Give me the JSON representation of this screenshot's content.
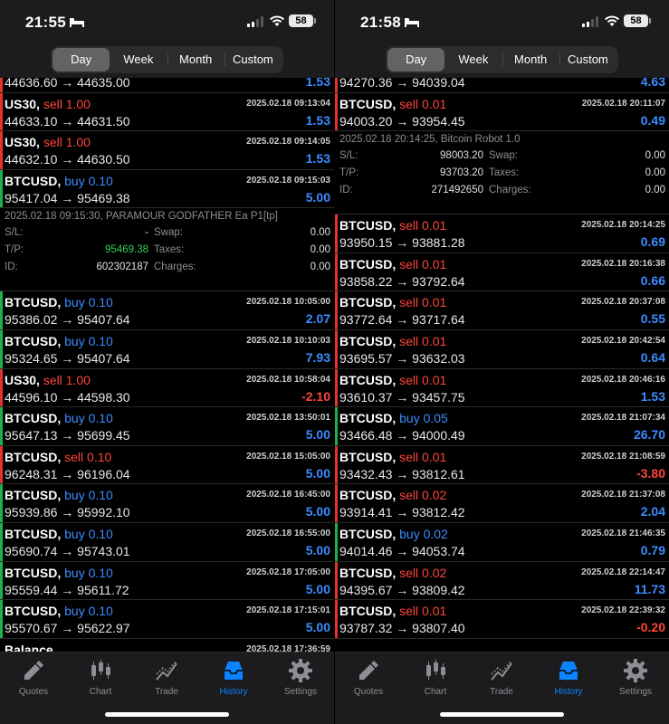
{
  "colors": {
    "buy": "#3b8cff",
    "sell": "#ff453a",
    "positive": "#3b8cff",
    "negative": "#ff453a",
    "accent": "#0a84ff",
    "tp_green": "#30d158"
  },
  "tabs": [
    {
      "label": "Quotes",
      "icon": "quotes-icon"
    },
    {
      "label": "Chart",
      "icon": "chart-icon"
    },
    {
      "label": "Trade",
      "icon": "trade-icon"
    },
    {
      "label": "History",
      "icon": "history-icon",
      "active": true
    },
    {
      "label": "Settings",
      "icon": "settings-icon"
    }
  ],
  "segments": [
    "Day",
    "Week",
    "Month",
    "Custom"
  ],
  "screens": [
    {
      "time": "21:55",
      "battery": "58",
      "active_segment": "Day",
      "top_partial": {
        "bar": "red",
        "prices": "44636.60 → 44635.00",
        "pl": "1.53",
        "pl_class": "pos"
      },
      "rows": [
        {
          "type": "deal",
          "bar": "red",
          "symbol": "US30,",
          "side": "sell",
          "volume": "1.00",
          "datetime": "2025.02.18 09:13:04",
          "prices": "44633.10 → 44631.50",
          "pl": "1.53"
        },
        {
          "type": "deal",
          "bar": "red",
          "symbol": "US30,",
          "side": "sell",
          "volume": "1.00",
          "datetime": "2025.02.18 09:14:05",
          "prices": "44632.10 → 44630.50",
          "pl": "1.53"
        },
        {
          "type": "deal",
          "bar": "green",
          "symbol": "BTCUSD,",
          "side": "buy",
          "volume": "0.10",
          "datetime": "2025.02.18 09:15:03",
          "prices": "95417.04 → 95469.38",
          "pl": "5.00"
        },
        {
          "type": "detail",
          "header": "2025.02.18 09:15:30, PARAMOUR GODFATHER Ea P1[tp]",
          "sl_label": "S/L:",
          "sl": "-",
          "tp_label": "T/P:",
          "tp": "95469.38",
          "id_label": "ID:",
          "id": "602302187",
          "swap_label": "Swap:",
          "swap": "0.00",
          "taxes_label": "Taxes:",
          "taxes": "0.00",
          "charges_label": "Charges:",
          "charges": "0.00",
          "tp_green": true
        },
        {
          "type": "deal",
          "bar": "green",
          "symbol": "BTCUSD,",
          "side": "buy",
          "volume": "0.10",
          "datetime": "2025.02.18 10:05:00",
          "prices": "95386.02 → 95407.64",
          "pl": "2.07"
        },
        {
          "type": "deal",
          "bar": "green",
          "symbol": "BTCUSD,",
          "side": "buy",
          "volume": "0.10",
          "datetime": "2025.02.18 10:10:03",
          "prices": "95324.65 → 95407.64",
          "pl": "7.93"
        },
        {
          "type": "deal",
          "bar": "red",
          "symbol": "US30,",
          "side": "sell",
          "volume": "1.00",
          "datetime": "2025.02.18 10:58:04",
          "prices": "44596.10 → 44598.30",
          "pl": "-2.10"
        },
        {
          "type": "deal",
          "bar": "green",
          "symbol": "BTCUSD,",
          "side": "buy",
          "volume": "0.10",
          "datetime": "2025.02.18 13:50:01",
          "prices": "95647.13 → 95699.45",
          "pl": "5.00"
        },
        {
          "type": "deal",
          "bar": "red",
          "symbol": "BTCUSD,",
          "side": "sell",
          "volume": "0.10",
          "datetime": "2025.02.18 15:05:00",
          "prices": "96248.31 → 96196.04",
          "pl": "5.00"
        },
        {
          "type": "deal",
          "bar": "green",
          "symbol": "BTCUSD,",
          "side": "buy",
          "volume": "0.10",
          "datetime": "2025.02.18 16:45:00",
          "prices": "95939.86 → 95992.10",
          "pl": "5.00"
        },
        {
          "type": "deal",
          "bar": "green",
          "symbol": "BTCUSD,",
          "side": "buy",
          "volume": "0.10",
          "datetime": "2025.02.18 16:55:00",
          "prices": "95690.74 → 95743.01",
          "pl": "5.00"
        },
        {
          "type": "deal",
          "bar": "green",
          "symbol": "BTCUSD,",
          "side": "buy",
          "volume": "0.10",
          "datetime": "2025.02.18 17:05:00",
          "prices": "95559.44 → 95611.72",
          "pl": "5.00"
        },
        {
          "type": "deal",
          "bar": "green",
          "symbol": "BTCUSD,",
          "side": "buy",
          "volume": "0.10",
          "datetime": "2025.02.18 17:15:01",
          "prices": "95570.67 → 95622.97",
          "pl": "5.00"
        },
        {
          "type": "balance",
          "symbol": "Balance",
          "datetime": "2025.02.18 17:36:59"
        }
      ]
    },
    {
      "time": "21:58",
      "battery": "58",
      "active_segment": "Day",
      "top_partial": {
        "bar": "red",
        "prices": "94270.36 → 94039.04",
        "pl": "4.63",
        "pl_class": "pos"
      },
      "rows": [
        {
          "type": "deal",
          "bar": "red",
          "symbol": "BTCUSD,",
          "side": "sell",
          "volume": "0.01",
          "datetime": "2025.02.18 20:11:07",
          "prices": "94003.20 → 93954.45",
          "pl": "0.49"
        },
        {
          "type": "detail",
          "header": "2025.02.18 20:14:25, Bitcoin Robot  1.0",
          "sl_label": "S/L:",
          "sl": "98003.20",
          "tp_label": "T/P:",
          "tp": "93703.20",
          "id_label": "ID:",
          "id": "271492650",
          "swap_label": "Swap:",
          "swap": "0.00",
          "taxes_label": "Taxes:",
          "taxes": "0.00",
          "charges_label": "Charges:",
          "charges": "0.00",
          "tp_green": false
        },
        {
          "type": "deal",
          "bar": "red",
          "symbol": "BTCUSD,",
          "side": "sell",
          "volume": "0.01",
          "datetime": "2025.02.18 20:14:25",
          "prices": "93950.15 → 93881.28",
          "pl": "0.69"
        },
        {
          "type": "deal",
          "bar": "red",
          "symbol": "BTCUSD,",
          "side": "sell",
          "volume": "0.01",
          "datetime": "2025.02.18 20:16:38",
          "prices": "93858.22 → 93792.64",
          "pl": "0.66"
        },
        {
          "type": "deal",
          "bar": "red",
          "symbol": "BTCUSD,",
          "side": "sell",
          "volume": "0.01",
          "datetime": "2025.02.18 20:37:08",
          "prices": "93772.64 → 93717.64",
          "pl": "0.55"
        },
        {
          "type": "deal",
          "bar": "red",
          "symbol": "BTCUSD,",
          "side": "sell",
          "volume": "0.01",
          "datetime": "2025.02.18 20:42:54",
          "prices": "93695.57 → 93632.03",
          "pl": "0.64"
        },
        {
          "type": "deal",
          "bar": "red",
          "symbol": "BTCUSD,",
          "side": "sell",
          "volume": "0.01",
          "datetime": "2025.02.18 20:46:16",
          "prices": "93610.37 → 93457.75",
          "pl": "1.53"
        },
        {
          "type": "deal",
          "bar": "green",
          "symbol": "BTCUSD,",
          "side": "buy",
          "volume": "0.05",
          "datetime": "2025.02.18 21:07:34",
          "prices": "93466.48 → 94000.49",
          "pl": "26.70"
        },
        {
          "type": "deal",
          "bar": "red",
          "symbol": "BTCUSD,",
          "side": "sell",
          "volume": "0.01",
          "datetime": "2025.02.18 21:08:59",
          "prices": "93432.43 → 93812.61",
          "pl": "-3.80"
        },
        {
          "type": "deal",
          "bar": "red",
          "symbol": "BTCUSD,",
          "side": "sell",
          "volume": "0.02",
          "datetime": "2025.02.18 21:37:08",
          "prices": "93914.41 → 93812.42",
          "pl": "2.04"
        },
        {
          "type": "deal",
          "bar": "green",
          "symbol": "BTCUSD,",
          "side": "buy",
          "volume": "0.02",
          "datetime": "2025.02.18 21:46:35",
          "prices": "94014.46 → 94053.74",
          "pl": "0.79"
        },
        {
          "type": "deal",
          "bar": "red",
          "symbol": "BTCUSD,",
          "side": "sell",
          "volume": "0.02",
          "datetime": "2025.02.18 22:14:47",
          "prices": "94395.67 → 93809.42",
          "pl": "11.73"
        },
        {
          "type": "deal",
          "bar": "red",
          "symbol": "BTCUSD,",
          "side": "sell",
          "volume": "0.01",
          "datetime": "2025.02.18 22:39:32",
          "prices": "93787.32 → 93807.40",
          "pl": "-0.20"
        }
      ]
    }
  ]
}
